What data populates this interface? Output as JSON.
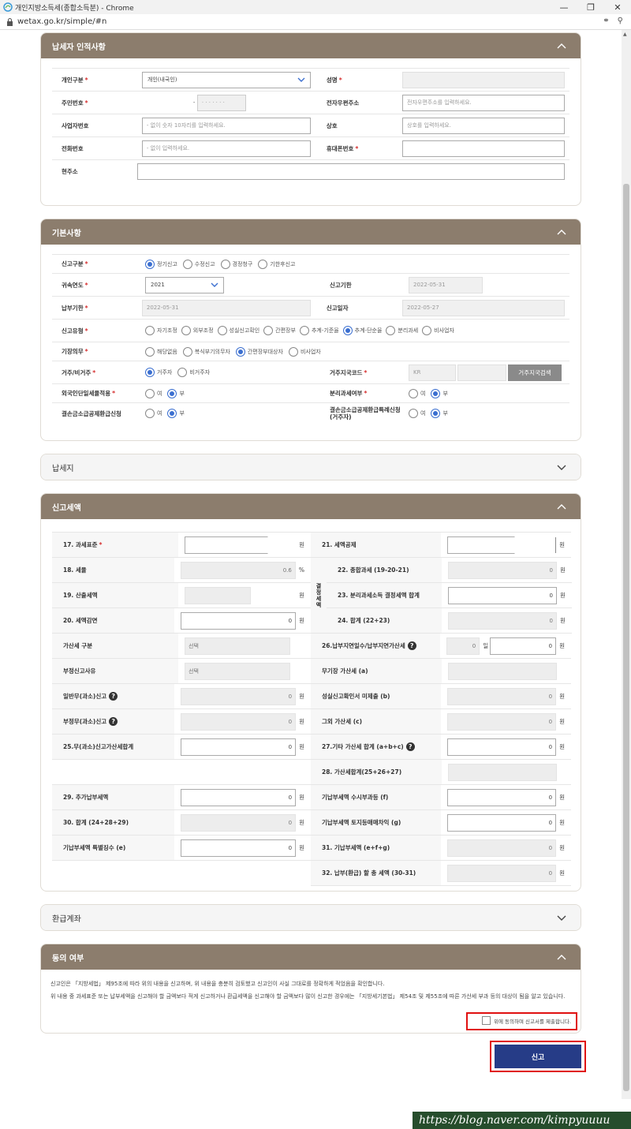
{
  "window": {
    "title": "개인지방소득세(종합소득분) - Chrome",
    "url": "wetax.go.kr/simple/#n"
  },
  "taxpayer": {
    "title": "납세자 인적사항",
    "personal_type_label": "개인구분",
    "personal_type_value": "개인(내국인)",
    "name_label": "성명",
    "resident_no_label": "주민번호",
    "resident_no_back": "· · · · · · ·",
    "email_label": "전자우편주소",
    "email_placeholder": "전자우편주소를 입력하세요.",
    "biz_no_label": "사업자번호",
    "biz_no_placeholder": "- 없이 숫자 10자리를 입력하세요.",
    "trade_name_label": "상호",
    "trade_name_placeholder": "상호를 입력하세요.",
    "phone_label": "전화번호",
    "phone_placeholder": "- 없이 입력하세요.",
    "mobile_label": "휴대폰번호",
    "address_label": "현주소"
  },
  "basic": {
    "title": "기본사항",
    "report_type_label": "신고구분",
    "report_type_options": [
      "정기신고",
      "수정신고",
      "경정청구",
      "기한후신고"
    ],
    "year_label": "귀속연도",
    "year_value": "2021",
    "deadline_label": "신고기한",
    "deadline_value": "2022-05-31",
    "pay_deadline_label": "납부기한",
    "pay_deadline_value": "2022-05-31",
    "report_date_label": "신고일자",
    "report_date_value": "2022-05-27",
    "report_kind_label": "신고유형",
    "report_kind_options": [
      "자기조정",
      "외부조정",
      "성실신고확인",
      "간편장부",
      "추계-기준율",
      "추계-단순율",
      "분리과세",
      "비사업자"
    ],
    "bookkeeping_label": "기장의무",
    "bookkeeping_options": [
      "해당없음",
      "복식부기의무자",
      "간편장부대상자",
      "비사업자"
    ],
    "residency_label": "거주/비거주",
    "residency_options": [
      "거주자",
      "비거주자"
    ],
    "residency_code_label": "거주지국코드",
    "residency_code_value": "KR",
    "residency_search_button": "거주지국검색",
    "foreign_tax_label": "외국인단일세율적용",
    "separate_tax_label": "분리과세여부",
    "deficit_label": "결손금소급공제환급신청",
    "deficit_special_label": "결손금소급공제환급특례신청(거주자)",
    "yes": "여",
    "no": "부"
  },
  "tax_office": {
    "title": "납세지"
  },
  "tax_amount": {
    "title": "신고세액",
    "items": {
      "l17": "17. 과세표준",
      "l18": "18. 세율",
      "l18v": "0.6",
      "l19": "19. 산출세액",
      "l20": "20. 세액감면",
      "l21": "21. 세액공제",
      "l22": "22. 종합과세 (19-20-21)",
      "l23": "23. 분리과세소득 결정세액 합계",
      "l24": "24. 합계 (22+23)",
      "decided": "결정세액",
      "addtax_kind": "가산세 구분",
      "addtax_kind_v": "선택",
      "unfair_reason": "부정신고사유",
      "unfair_reason_v": "선택",
      "general_under": "일반무(과소)신고",
      "unfair_under": "부정무(과소)신고",
      "l25": "25.무(과소)신고가산세합계",
      "l26": "26.납부지연일수/납부지연가산세",
      "day_unit": "일",
      "no_book": "무기장 가산세 (a)",
      "no_confirm": "성실신고확인서 미제출 (b)",
      "other_add": "그외 가산세 (c)",
      "l27": "27.기타 가산세 합계 (a+b+c)",
      "l28": "28. 가산세합계(25+26+27)",
      "l29": "29. 추가납부세액",
      "l30": "30. 합계 (24+28+29)",
      "special_levy": "기납부세액 특별징수 (e)",
      "occasional": "기납부세액 수시부과등 (f)",
      "land_sale": "기납부세액 토지등매매차익 (g)",
      "l31": "31. 기납부세액 (e+f+g)",
      "l32": "32. 납부(환급) 할 총 세액 (30-31)",
      "won": "원",
      "pct": "%",
      "zero": "0"
    }
  },
  "refund": {
    "title": "환급계좌"
  },
  "consent": {
    "title": "동의 여부",
    "text1": "신고인은 「지방세법」 제95조에 따라 위의 내용을 신고하며, 위 내용을 충분히 검토했고 신고인이 사실 그대로를 정확하게 적었음을 확인합니다.",
    "text2": "위 내용 중 과세표준 또는 납부세액을 신고해야 할 금액보다 적게 신고하거나 환급세액을 신고해야 할 금액보다 많이 신고한 경우에는 「지방세기본법」 제54조 및 제55조에 따른 가산세 부과 등의 대상이 됨을 알고 있습니다.",
    "agree_label": "위에 동의하며 신고서를 제출합니다."
  },
  "submit_label": "신고",
  "watermark": "https://blog.naver.com/kimpyuuuu"
}
